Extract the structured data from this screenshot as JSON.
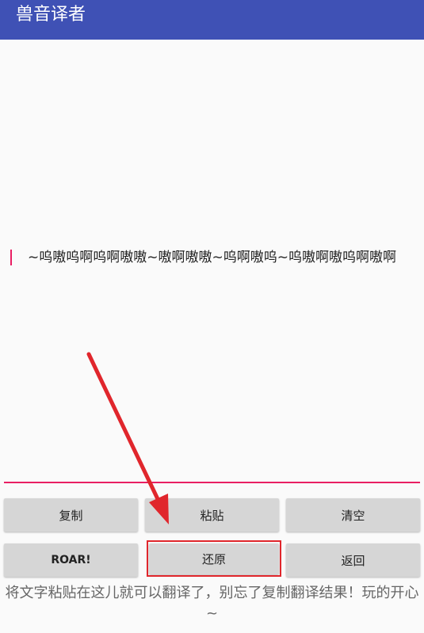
{
  "app": {
    "title": "兽音译者"
  },
  "editor": {
    "text": "~呜嗷呜啊呜啊嗷嗷~嗷啊嗷嗷~呜啊嗷呜~呜嗷啊嗷呜啊嗷啊"
  },
  "buttons": {
    "copy": "复制",
    "paste": "粘贴",
    "clear": "清空",
    "roar": "ROAR!",
    "restore": "还原",
    "back": "返回"
  },
  "hint": {
    "text": "将文字粘贴在这儿就可以翻译了，别忘了复制翻译结果！玩的开心~"
  },
  "annotation": {
    "color": "#e0262c"
  }
}
